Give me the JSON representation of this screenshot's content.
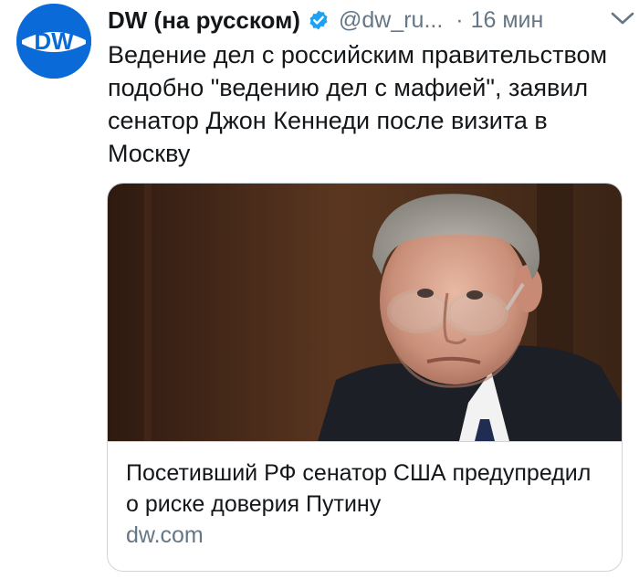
{
  "tweet": {
    "avatar_text": "DW",
    "display_name": "DW (на русском)",
    "verified_icon": "verified-badge-icon",
    "handle": "@dw_ru...",
    "separator": "·",
    "time": "16 мин",
    "menu_icon": "chevron-down-icon",
    "text": "Ведение дел с российским правительством подобно \"ведению дел с мафией\", заявил сенатор Джон Кеннеди после визита в Москву"
  },
  "card": {
    "title": "Посетивший РФ сенатор США предупредил о риске доверия Путину",
    "domain": "dw.com"
  },
  "colors": {
    "brand_blue": "#0a6bd8",
    "verified_blue": "#1da1f2",
    "secondary_text": "#657786",
    "primary_text": "#14171a",
    "border": "#ccd6dd"
  }
}
